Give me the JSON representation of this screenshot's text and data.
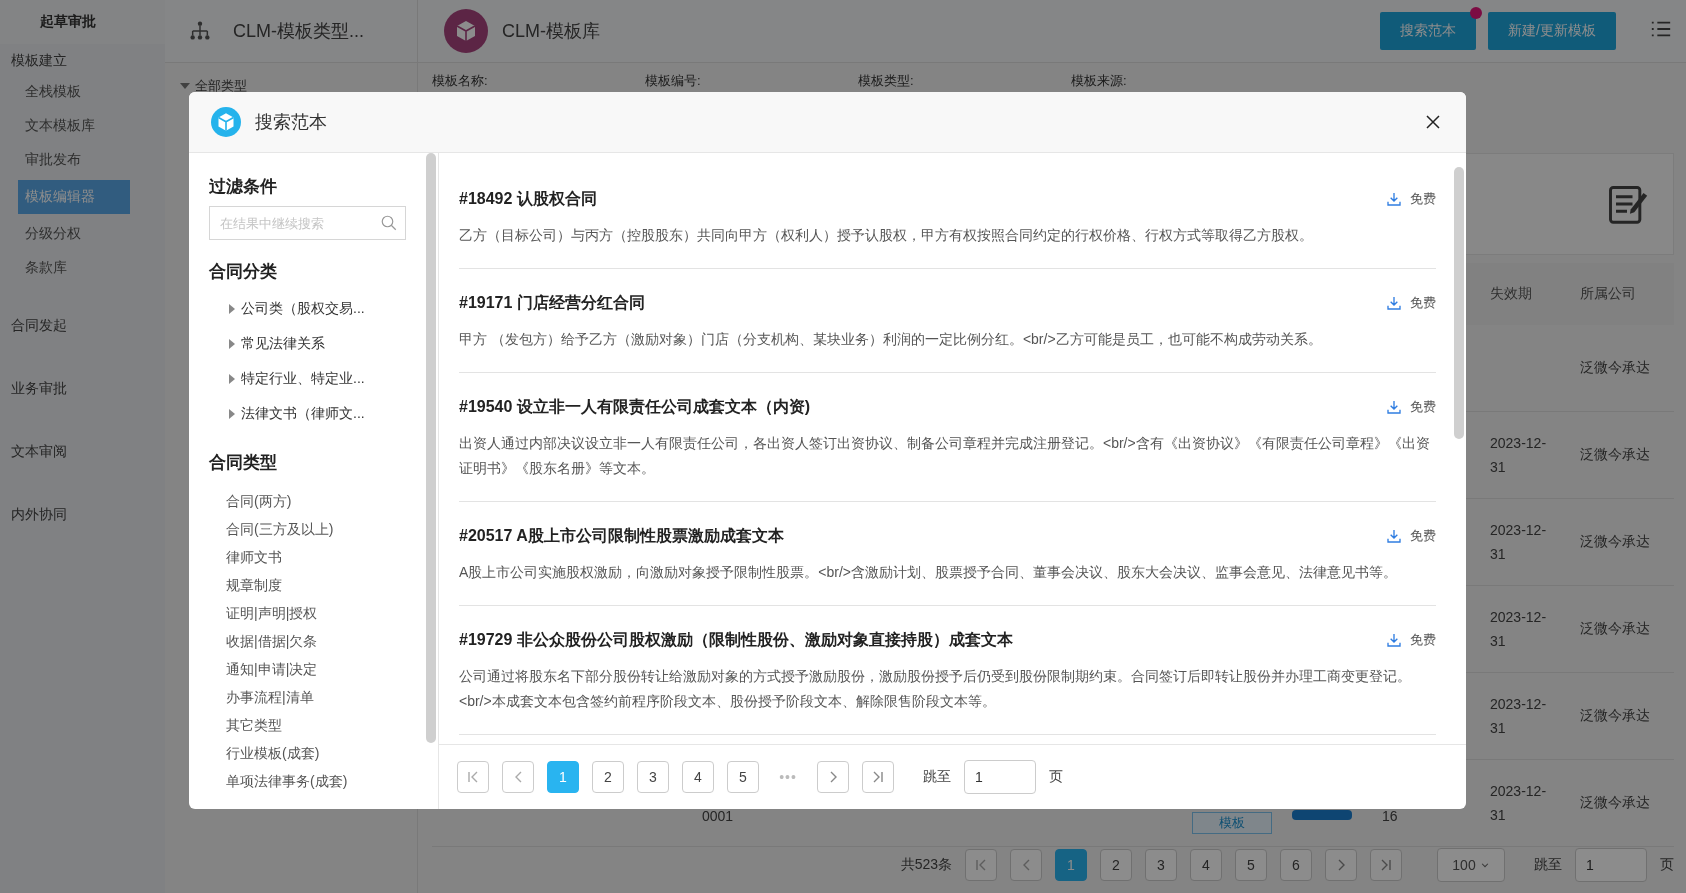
{
  "sidebar": {
    "title": "起草审批",
    "groups": [
      {
        "label": "模板建立",
        "children": [
          {
            "label": "全栈模板",
            "selected": false
          },
          {
            "label": "文本模板库",
            "selected": false
          },
          {
            "label": "审批发布",
            "selected": false
          },
          {
            "label": "模板编辑器",
            "selected": true
          },
          {
            "label": "分级分权",
            "selected": false
          },
          {
            "label": "条款库",
            "selected": false
          }
        ]
      },
      {
        "label": "合同发起"
      },
      {
        "label": "业务审批"
      },
      {
        "label": "文本审阅"
      },
      {
        "label": "内外协同"
      }
    ]
  },
  "header": {
    "tabs": [
      {
        "label": "CLM-模板类型...",
        "kind": "tree"
      },
      {
        "label": "CLM-模板库",
        "kind": "logo"
      }
    ],
    "buttons": [
      {
        "label": "搜索范本",
        "badge": true
      },
      {
        "label": "新建/更新模板",
        "badge": false
      }
    ]
  },
  "tree": {
    "root": "全部类型",
    "expanded": true
  },
  "filters": [
    "模板名称:",
    "模板编号:",
    "模板类型:",
    "模板来源:"
  ],
  "table": {
    "columns": [
      "失效期",
      "所属公司"
    ],
    "rows": [
      {
        "expiry": "",
        "company": "泛微今承达"
      },
      {
        "expiry": "2023-12-31",
        "company": "泛微今承达"
      },
      {
        "expiry": "2023-12-31",
        "company": "泛微今承达"
      },
      {
        "expiry": "2023-12-31",
        "company": "泛微今承达"
      },
      {
        "expiry": "2023-12-31",
        "company": "泛微今承达"
      },
      {
        "expiry": "2023-12-31",
        "company": "泛微今承达",
        "code": "0001",
        "tag": "模板",
        "count": "16"
      }
    ]
  },
  "pagination": {
    "total": "共523条",
    "pages": [
      {
        "label": "1",
        "selected": true
      },
      {
        "label": "2",
        "selected": false
      },
      {
        "label": "3",
        "selected": false
      },
      {
        "label": "4",
        "selected": false
      },
      {
        "label": "5",
        "selected": false
      },
      {
        "label": "6",
        "selected": false
      }
    ],
    "page_size": "100",
    "jump_label": "跳至",
    "jump_value": "1",
    "unit": "页"
  },
  "modal": {
    "title": "搜索范本",
    "filter": {
      "heading": "过滤条件",
      "placeholder": "在结果中继续搜索"
    },
    "categories": {
      "heading": "合同分类",
      "items": [
        {
          "label": "公司类（股权交易...",
          "expanded": false
        },
        {
          "label": "常见法律关系",
          "expanded": false
        },
        {
          "label": "特定行业、特定业...",
          "expanded": false
        },
        {
          "label": "法律文书（律师文...",
          "expanded": false
        }
      ]
    },
    "types": {
      "heading": "合同类型",
      "items": [
        "合同(两方)",
        "合同(三方及以上)",
        "律师文书",
        "规章制度",
        "证明|声明|授权",
        "收据|借据|欠条",
        "通知|申请|决定",
        "办事流程|清单",
        "其它类型",
        "行业模板(成套)",
        "单项法律事务(成套)"
      ]
    },
    "results": [
      {
        "title": "#18492 认股权合同",
        "description": "乙方（目标公司）与丙方（控股股东）共同向甲方（权利人）授予认股权，甲方有权按照合同约定的行权价格、行权方式等取得乙方股权。",
        "price": "免费"
      },
      {
        "title": "#19171 门店经营分红合同",
        "description": "甲方 （发包方）给予乙方（激励对象）门店（分支机构、某块业务）利润的一定比例分红。<br/>乙方可能是员工，也可能不构成劳动关系。",
        "price": "免费"
      },
      {
        "title": "#19540 设立非一人有限责任公司成套文本（内资)",
        "description": "出资人通过内部决议设立非一人有限责任公司，各出资人签订出资协议、制备公司章程并完成注册登记。<br/>含有《出资协议》《有限责任公司章程》《出资证明书》《股东名册》等文本。",
        "price": "免费"
      },
      {
        "title": "#20517 A股上市公司限制性股票激励成套文本",
        "description": "A股上市公司实施股权激励，向激励对象授予限制性股票。<br/>含激励计划、股票授予合同、董事会决议、股东大会决议、监事会意见、法律意见书等。",
        "price": "免费"
      },
      {
        "title": "#19729 非公众股份公司股权激励（限制性股份、激励对象直接持股）成套文本",
        "description": "公司通过将股东名下部分股份转让给激励对象的方式授予激励股份，激励股份授予后仍受到股份限制期约束。合同签订后即转让股份并办理工商变更登记。<br/>本成套文本包含签约前程序阶段文本、股份授予阶段文本、解除限售阶段文本等。",
        "price": "免费"
      }
    ],
    "pagination": {
      "pages": [
        {
          "label": "1",
          "selected": true
        },
        {
          "label": "2",
          "selected": false
        },
        {
          "label": "3",
          "selected": false
        },
        {
          "label": "4",
          "selected": false
        },
        {
          "label": "5",
          "selected": false
        }
      ],
      "ellipsis": "•••",
      "jump_label": "跳至",
      "jump_value": "1",
      "unit": "页"
    }
  }
}
